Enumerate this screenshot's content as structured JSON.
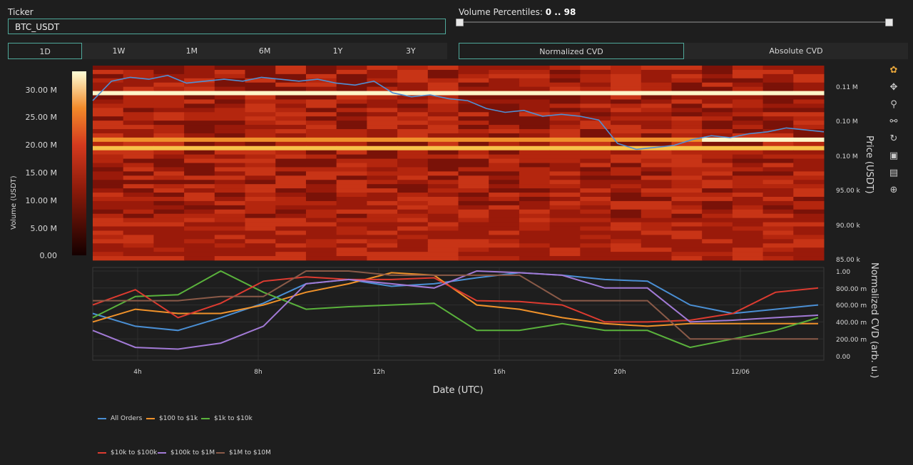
{
  "ticker": {
    "label": "Ticker",
    "value": "BTC_USDT"
  },
  "volume_percentiles": {
    "label": "Volume Percentiles:",
    "value": "0 .. 98",
    "low": 0,
    "high": 98
  },
  "ranges": [
    "1D",
    "1W",
    "1M",
    "6M",
    "1Y",
    "3Y"
  ],
  "active_range": "1D",
  "cvd_modes": [
    "Normalized CVD",
    "Absolute CVD"
  ],
  "active_cvd_mode": "Normalized CVD",
  "toolbar_icons": [
    "plotly-logo-icon",
    "pan-icon",
    "zoom-icon",
    "autoscale-icon",
    "reset-icon",
    "download-icon",
    "hover-icon",
    "spike-icon"
  ],
  "colors": {
    "accent": "#4fa89a",
    "price_line": "#4f8fd6",
    "bg": "#1e1e1e"
  },
  "chart_data": [
    {
      "type": "heatmap",
      "title": "",
      "colorbar_label": "Volume (USDT)",
      "colorbar_ticks": [
        "0.00",
        "5.00 M",
        "10.00 M",
        "15.00 M",
        "20.00 M",
        "25.00 M",
        "30.00 M"
      ],
      "ylabel": "Price (USDT)",
      "y_ticks": [
        "0.11 M",
        "0.10 M",
        "0.10 M",
        "95.00 k",
        "90.00 k",
        "85.00 k"
      ],
      "price_series": [
        82,
        92,
        94,
        93,
        95,
        91,
        92,
        93,
        92,
        94,
        93,
        92,
        93,
        91,
        90,
        92,
        86,
        84,
        85,
        83,
        82,
        78,
        76,
        77,
        74,
        75,
        74,
        72,
        60,
        57,
        58,
        59,
        62,
        64,
        63,
        65,
        66,
        68,
        67,
        66
      ]
    },
    {
      "type": "line",
      "xlabel": "Date (UTC)",
      "ylabel": "Normalized CVD (arb. u.)",
      "x_ticks": [
        "4h",
        "8h",
        "12h",
        "16h",
        "20h",
        "12/06"
      ],
      "y_ticks": [
        "0.00",
        "200.00 m",
        "400.00 m",
        "600.00 m",
        "800.00 m",
        "1.00"
      ],
      "ylim": [
        0,
        1
      ],
      "series": [
        {
          "name": "All Orders",
          "color": "#4a8fd4",
          "values": [
            0.5,
            0.35,
            0.3,
            0.45,
            0.62,
            0.85,
            0.9,
            0.82,
            0.85,
            0.92,
            0.98,
            0.95,
            0.9,
            0.88,
            0.6,
            0.5,
            0.55,
            0.6
          ]
        },
        {
          "name": "$100 to $1k",
          "color": "#f0922a",
          "values": [
            0.4,
            0.55,
            0.5,
            0.5,
            0.6,
            0.75,
            0.85,
            0.98,
            0.95,
            0.6,
            0.55,
            0.45,
            0.38,
            0.35,
            0.38,
            0.38,
            0.38,
            0.38
          ]
        },
        {
          "name": "$1k to $10k",
          "color": "#5ab23c",
          "values": [
            0.45,
            0.7,
            0.72,
            1.0,
            0.75,
            0.55,
            0.58,
            0.6,
            0.62,
            0.3,
            0.3,
            0.38,
            0.3,
            0.3,
            0.1,
            0.2,
            0.3,
            0.45
          ]
        },
        {
          "name": "$10k to $100k",
          "color": "#dd3b30",
          "values": [
            0.6,
            0.78,
            0.45,
            0.62,
            0.88,
            0.93,
            0.9,
            0.9,
            0.92,
            0.65,
            0.64,
            0.6,
            0.4,
            0.4,
            0.42,
            0.5,
            0.75,
            0.8
          ]
        },
        {
          "name": "$100k to $1M",
          "color": "#a27ad6",
          "values": [
            0.3,
            0.1,
            0.08,
            0.15,
            0.35,
            0.85,
            0.9,
            0.85,
            0.8,
            1.0,
            0.98,
            0.95,
            0.8,
            0.8,
            0.4,
            0.42,
            0.45,
            0.48
          ]
        },
        {
          "name": "$1M to $10M",
          "color": "#8a5a48",
          "values": [
            0.65,
            0.65,
            0.65,
            0.7,
            0.7,
            1.0,
            1.0,
            0.95,
            0.95,
            0.95,
            0.95,
            0.65,
            0.65,
            0.65,
            0.2,
            0.2,
            0.2,
            0.2
          ]
        }
      ]
    }
  ]
}
